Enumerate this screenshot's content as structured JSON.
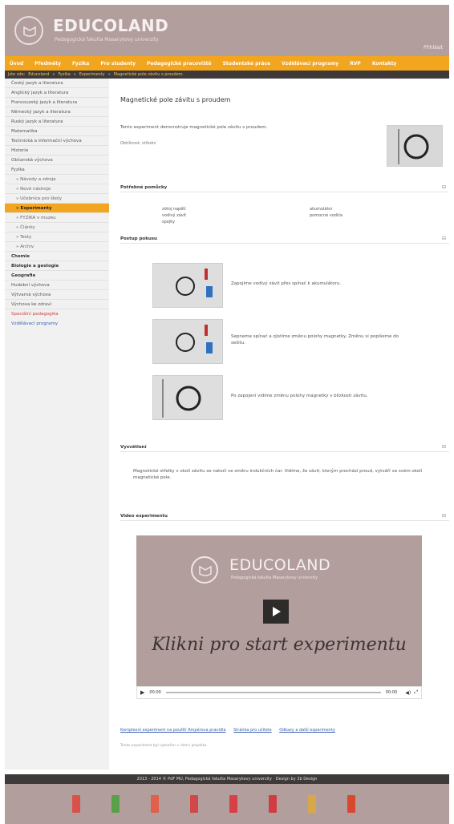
{
  "header": {
    "logo_text": "EDUCOLAND",
    "logo_subtitle": "Pedagogická fakulta Masarykovy univerzity",
    "right_link": "Přihlásit"
  },
  "nav": {
    "items": [
      "Úvod",
      "Předměty",
      "Fyzika",
      "Pro studenty",
      "Pedagogické pracoviště",
      "Studentské práce",
      "Vzdělávací programy",
      "RVP",
      "Kontakty"
    ]
  },
  "breadcrumb": [
    "Jste zde:",
    "Educoland",
    "»",
    "Fyzika",
    "»",
    "Experimenty",
    "»",
    "Magnetické pole závitu s proudem"
  ],
  "sidebar": {
    "items": [
      {
        "label": "Český jazyk a literatura",
        "cls": ""
      },
      {
        "label": "Anglický jazyk a literatura",
        "cls": ""
      },
      {
        "label": "Francouzský jazyk a literatura",
        "cls": ""
      },
      {
        "label": "Německý jazyk a literatura",
        "cls": ""
      },
      {
        "label": "Ruský jazyk a literatura",
        "cls": ""
      },
      {
        "label": "Matematika",
        "cls": ""
      },
      {
        "label": "Technická a informační výchova",
        "cls": ""
      },
      {
        "label": "Historie",
        "cls": ""
      },
      {
        "label": "Občanská výchova",
        "cls": ""
      },
      {
        "label": "Fyzika",
        "cls": ""
      },
      {
        "label": "» Návody a zdroje",
        "cls": "sub"
      },
      {
        "label": "» Nové nástroje",
        "cls": "sub"
      },
      {
        "label": "» Učebnice pro školy",
        "cls": "sub"
      },
      {
        "label": "» Experimenty",
        "cls": "sub active"
      },
      {
        "label": "» FYZIKA v muzeu",
        "cls": "sub"
      },
      {
        "label": "» Články",
        "cls": "sub"
      },
      {
        "label": "» Testy",
        "cls": "sub"
      },
      {
        "label": "» Archiv",
        "cls": "sub"
      },
      {
        "label": "Chemie",
        "cls": "bold"
      },
      {
        "label": "Biologie a geologie",
        "cls": "bold"
      },
      {
        "label": "Geografie",
        "cls": "bold"
      },
      {
        "label": "Hudební výchova",
        "cls": ""
      },
      {
        "label": "Výtvarná výchova",
        "cls": ""
      },
      {
        "label": "Výchova ke zdraví",
        "cls": ""
      },
      {
        "label": "Speciální pedagogika",
        "cls": "red"
      },
      {
        "label": "Vzdělávací programy",
        "cls": "blue"
      }
    ]
  },
  "main": {
    "title": "Magnetické pole závitu s proudem",
    "intro": "Tento experiment demonstruje magnetické pole závitu s proudem.",
    "meta": "Obtížnost: střední",
    "sections": {
      "tools": "Potřebné pomůcky",
      "procedure": "Postup pokusu",
      "conclusion": "Vysvětlení",
      "video": "Video experimentu"
    },
    "toggle_symbol": "⊟",
    "tools": [
      "zdroj napětí",
      "vodivý závit",
      "spojky",
      "akumulátor",
      "pomocné vodiče"
    ],
    "steps": [
      "Zapojíme vodivý závit přes spínač k akumulátoru.",
      "Sepneme spínač a zjistíme změnu polohy magnetky. Změnu si popíšeme do sešitu.",
      "Po zapojení vidíme změnu polohy magnetky v blízkosti závitu."
    ],
    "conclusion": "Magnetické střelky v okolí závitu se natočí ve směru indukčních čar. Vidíme, že závit, kterým prochází proud, vytváří ve svém okolí magnetické pole.",
    "video": {
      "logo_text": "EDUCOLAND",
      "logo_subtitle": "Pedagogická fakulta Masarykovy univerzity",
      "caption": "Klikni pro start experimentu",
      "time_start": "00:00",
      "time_end": "00:00"
    },
    "links": [
      "Komplexní experiment na použití Ampérova pravidla",
      "Stránka pro učitele",
      "Odkazy a další experimenty"
    ],
    "note": "Tento experiment byl vytvořen v rámci projektu."
  },
  "footer": {
    "text": "2013 - 2014 © PdF MU, Pedagogická fakulta Masarykovy univerzity · Design by 3b Design",
    "partner_colors": [
      "#d9524a",
      "#5aa048",
      "#e0604a",
      "#d04848",
      "#d84048",
      "#d03c40",
      "#d8a848",
      "#d84830"
    ]
  }
}
